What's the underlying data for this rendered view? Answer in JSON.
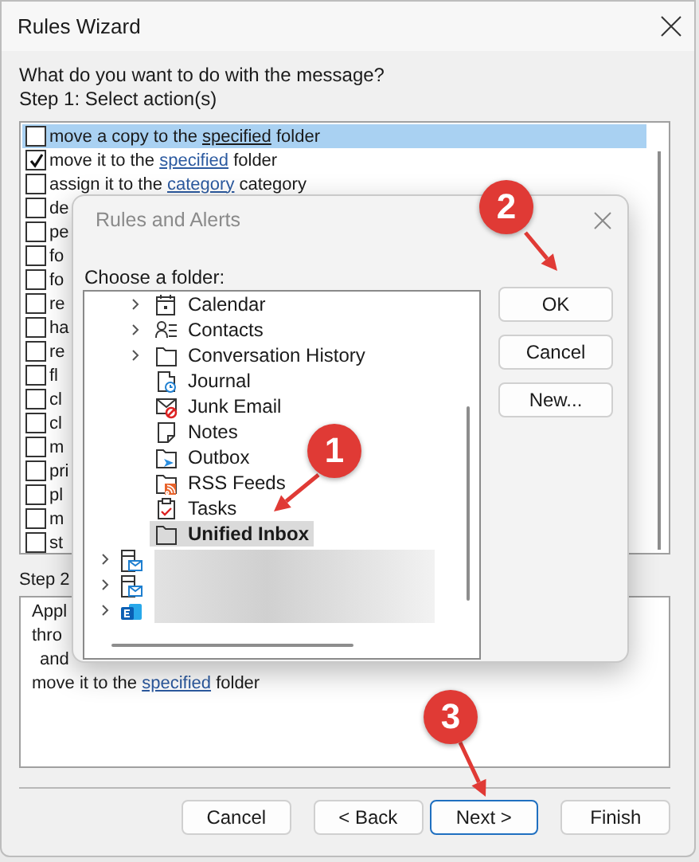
{
  "window": {
    "title": "Rules Wizard"
  },
  "question": "What do you want to do with the message?",
  "step1_label": "Step 1: Select action(s)",
  "actions": [
    {
      "parts": [
        {
          "text": "move a copy to the "
        },
        {
          "text": "specified",
          "link": true
        },
        {
          "text": " folder"
        }
      ],
      "checked": false,
      "selected": true
    },
    {
      "parts": [
        {
          "text": "move it to the "
        },
        {
          "text": "specified",
          "link": true
        },
        {
          "text": " folder"
        }
      ],
      "checked": true,
      "selected": false
    },
    {
      "parts": [
        {
          "text": "assign it to the "
        },
        {
          "text": "category",
          "link": true
        },
        {
          "text": " category"
        }
      ],
      "checked": false,
      "selected": false
    },
    {
      "parts": [
        {
          "text": "de"
        }
      ],
      "checked": false,
      "selected": false
    },
    {
      "parts": [
        {
          "text": "pe"
        }
      ],
      "checked": false,
      "selected": false
    },
    {
      "parts": [
        {
          "text": "fo"
        }
      ],
      "checked": false,
      "selected": false
    },
    {
      "parts": [
        {
          "text": "fo"
        }
      ],
      "checked": false,
      "selected": false
    },
    {
      "parts": [
        {
          "text": "re"
        }
      ],
      "checked": false,
      "selected": false
    },
    {
      "parts": [
        {
          "text": "ha"
        }
      ],
      "checked": false,
      "selected": false
    },
    {
      "parts": [
        {
          "text": "re"
        }
      ],
      "checked": false,
      "selected": false
    },
    {
      "parts": [
        {
          "text": "fl"
        }
      ],
      "checked": false,
      "selected": false
    },
    {
      "parts": [
        {
          "text": "cl"
        }
      ],
      "checked": false,
      "selected": false
    },
    {
      "parts": [
        {
          "text": "cl"
        }
      ],
      "checked": false,
      "selected": false
    },
    {
      "parts": [
        {
          "text": "m"
        }
      ],
      "checked": false,
      "selected": false
    },
    {
      "parts": [
        {
          "text": "pri"
        }
      ],
      "checked": false,
      "selected": false
    },
    {
      "parts": [
        {
          "text": "pl"
        }
      ],
      "checked": false,
      "selected": false
    },
    {
      "parts": [
        {
          "text": "m"
        }
      ],
      "checked": false,
      "selected": false
    },
    {
      "parts": [
        {
          "text": "st"
        }
      ],
      "checked": false,
      "selected": false
    }
  ],
  "step2_label": "Step 2",
  "description": [
    {
      "parts": [
        {
          "text": "Appl"
        }
      ],
      "indented": false
    },
    {
      "parts": [
        {
          "text": "thro"
        }
      ],
      "indented": false
    },
    {
      "parts": [
        {
          "text": "and"
        }
      ],
      "indented": true
    },
    {
      "parts": [
        {
          "text": "move it to the "
        },
        {
          "text": "specified",
          "link": true
        },
        {
          "text": " folder"
        }
      ],
      "indented": false
    }
  ],
  "buttons": [
    {
      "label": "Cancel",
      "default": false
    },
    {
      "label": "< Back",
      "default": false
    },
    {
      "label": "Next >",
      "default": true
    },
    {
      "label": "Finish",
      "default": false
    }
  ],
  "dialog": {
    "title": "Rules and Alerts",
    "prompt": "Choose a folder:",
    "folders": [
      {
        "name": "Calendar",
        "kind": "calendar",
        "has_subfolders": true,
        "selected": false
      },
      {
        "name": "Contacts",
        "kind": "contacts",
        "has_subfolders": true,
        "selected": false
      },
      {
        "name": "Conversation History",
        "kind": "folder",
        "has_subfolders": true,
        "selected": false
      },
      {
        "name": "Journal",
        "kind": "journal",
        "has_subfolders": false,
        "selected": false
      },
      {
        "name": "Junk Email",
        "kind": "junk",
        "has_subfolders": false,
        "selected": false
      },
      {
        "name": "Notes",
        "kind": "notes",
        "has_subfolders": false,
        "selected": false
      },
      {
        "name": "Outbox",
        "kind": "outbox",
        "has_subfolders": false,
        "selected": false
      },
      {
        "name": "RSS Feeds",
        "kind": "rss",
        "has_subfolders": false,
        "selected": false
      },
      {
        "name": "Tasks",
        "kind": "tasks",
        "has_subfolders": false,
        "selected": false
      },
      {
        "name": "Unified Inbox",
        "kind": "folder",
        "has_subfolders": false,
        "selected": true
      }
    ],
    "accounts": [
      {
        "kind": "mailbox",
        "has_subfolders": true
      },
      {
        "kind": "mailbox",
        "has_subfolders": true
      },
      {
        "kind": "exchange",
        "has_subfolders": true
      }
    ],
    "buttons": [
      "OK",
      "Cancel",
      "New..."
    ]
  },
  "annotations": [
    {
      "label": "1"
    },
    {
      "label": "2"
    },
    {
      "label": "3"
    }
  ]
}
